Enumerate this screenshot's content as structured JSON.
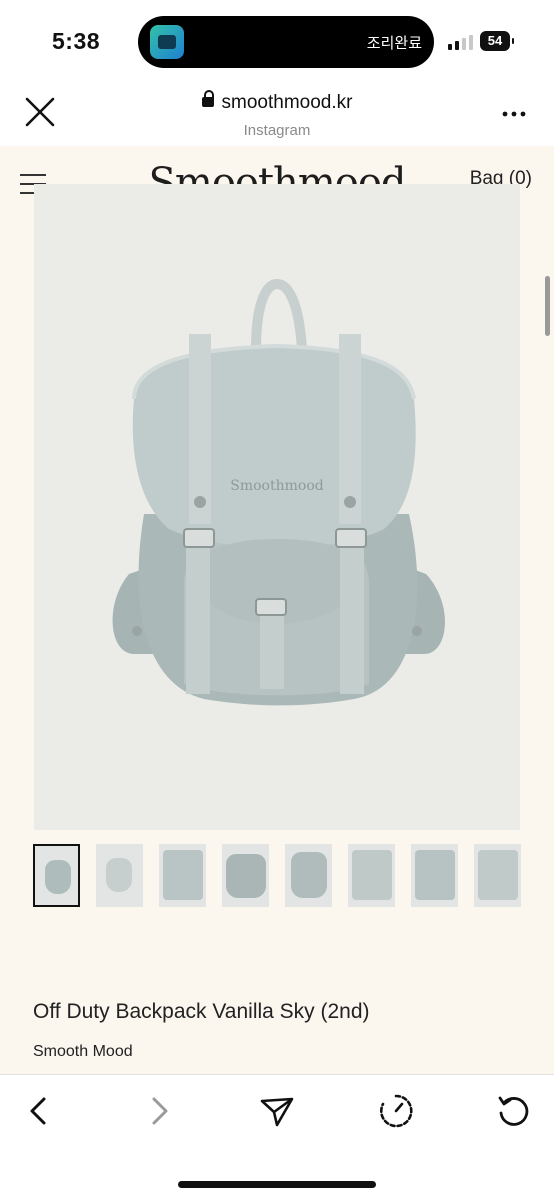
{
  "status_bar": {
    "time": "5:38",
    "activity_text": "조리완료",
    "battery": "54"
  },
  "browser": {
    "domain": "smoothmood.kr",
    "source": "Instagram"
  },
  "site": {
    "logo": "Smoothmood",
    "bag_label": "Bag (0)",
    "hero_image_alt": "Off Duty Backpack Vanilla Sky",
    "backpack_logo": "Smoothmood",
    "thumbnail_count": 8,
    "product_title": "Off Duty Backpack Vanilla Sky (2nd)",
    "brand": "Smooth Mood"
  },
  "toolbar": {
    "items": [
      "back-icon",
      "forward-icon",
      "share-icon",
      "timer-icon",
      "reload-icon"
    ]
  },
  "colors": {
    "page_bg": "#fbf6ee",
    "product_color": "#b7c4c4"
  }
}
